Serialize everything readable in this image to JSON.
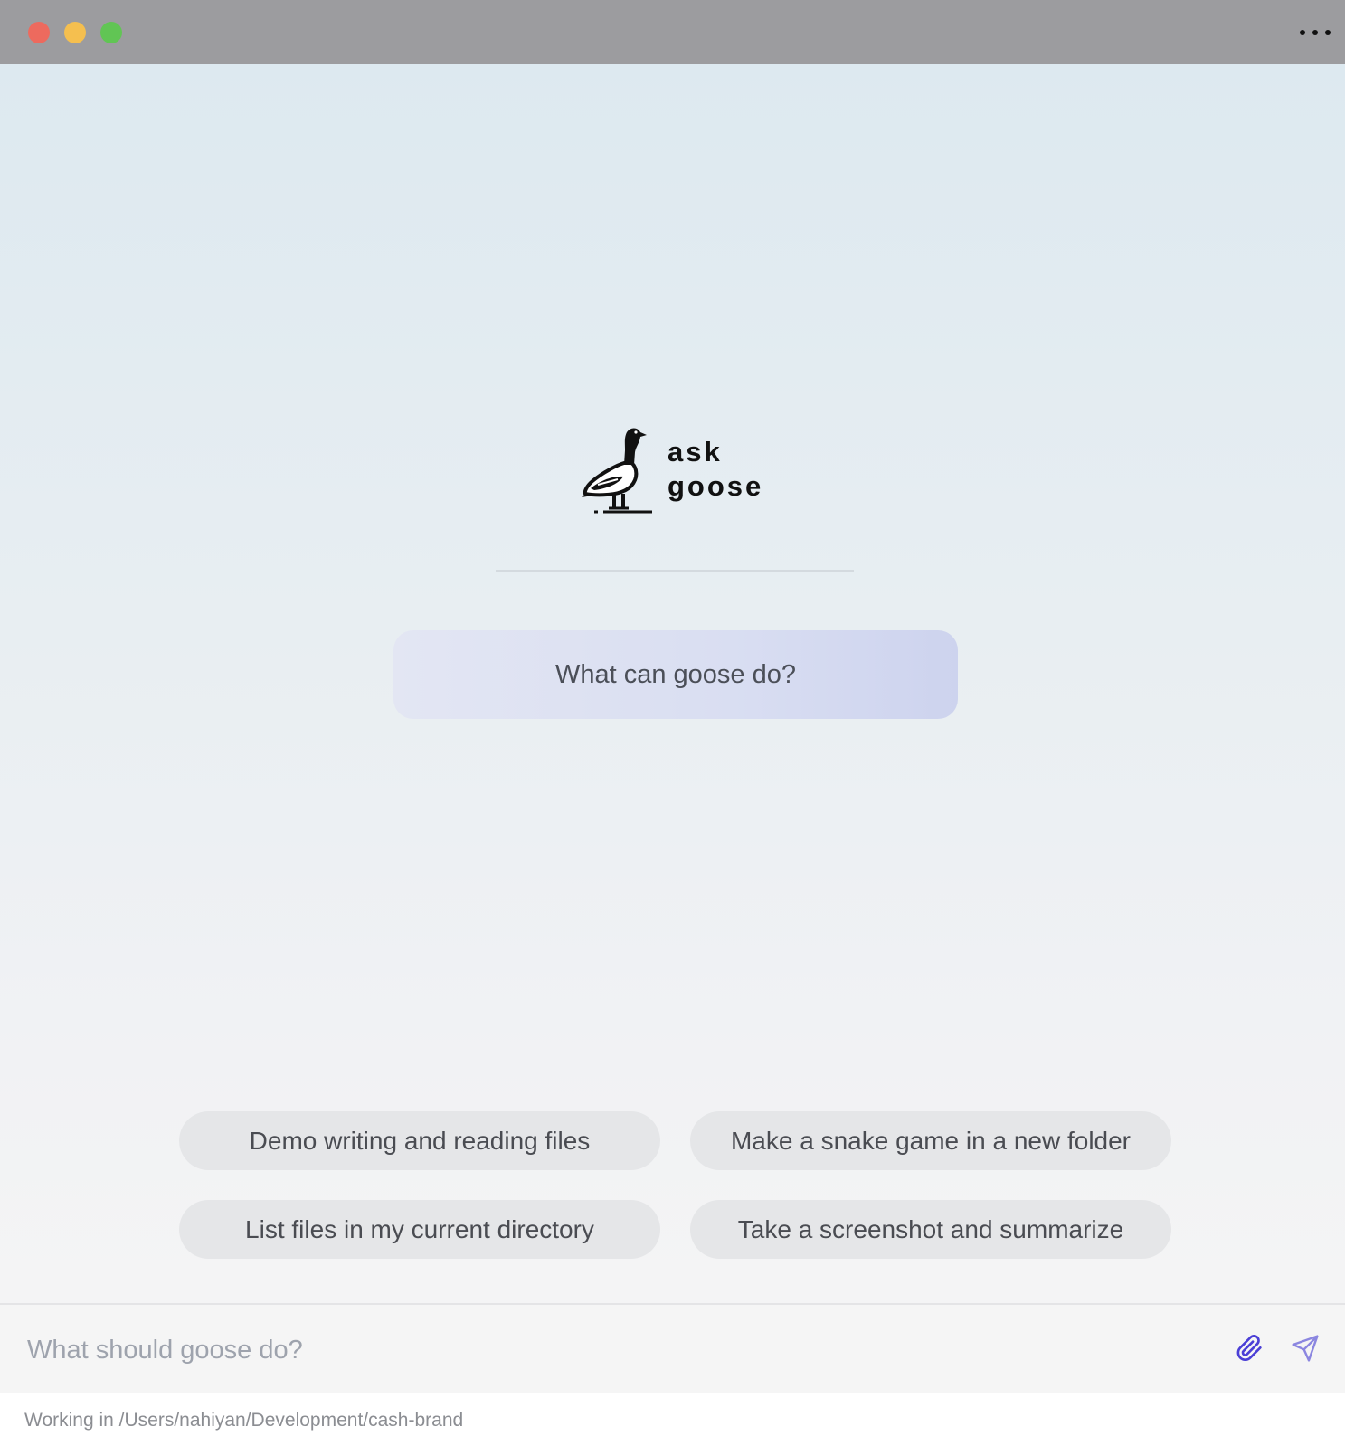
{
  "window": {
    "controls": [
      "close",
      "minimize",
      "maximize"
    ],
    "menu_icon": "more-horizontal-icon"
  },
  "branding": {
    "logo_line1": "ask",
    "logo_line2": "goose"
  },
  "main": {
    "ask_card_label": "What can goose do?",
    "suggestions": [
      "Demo writing and reading files",
      "Make a snake game in a new folder",
      "List files in my current directory",
      "Take a screenshot and summarize"
    ]
  },
  "input": {
    "placeholder": "What should goose do?",
    "value": ""
  },
  "status": {
    "working_dir": "Working in /Users/nahiyan/Development/cash-brand"
  },
  "colors": {
    "titlebar": "#9c9c9f",
    "accent": "#4b3fd6",
    "close": "#ed6a5e",
    "minimize": "#f5bf4f",
    "maximize": "#61c554"
  }
}
